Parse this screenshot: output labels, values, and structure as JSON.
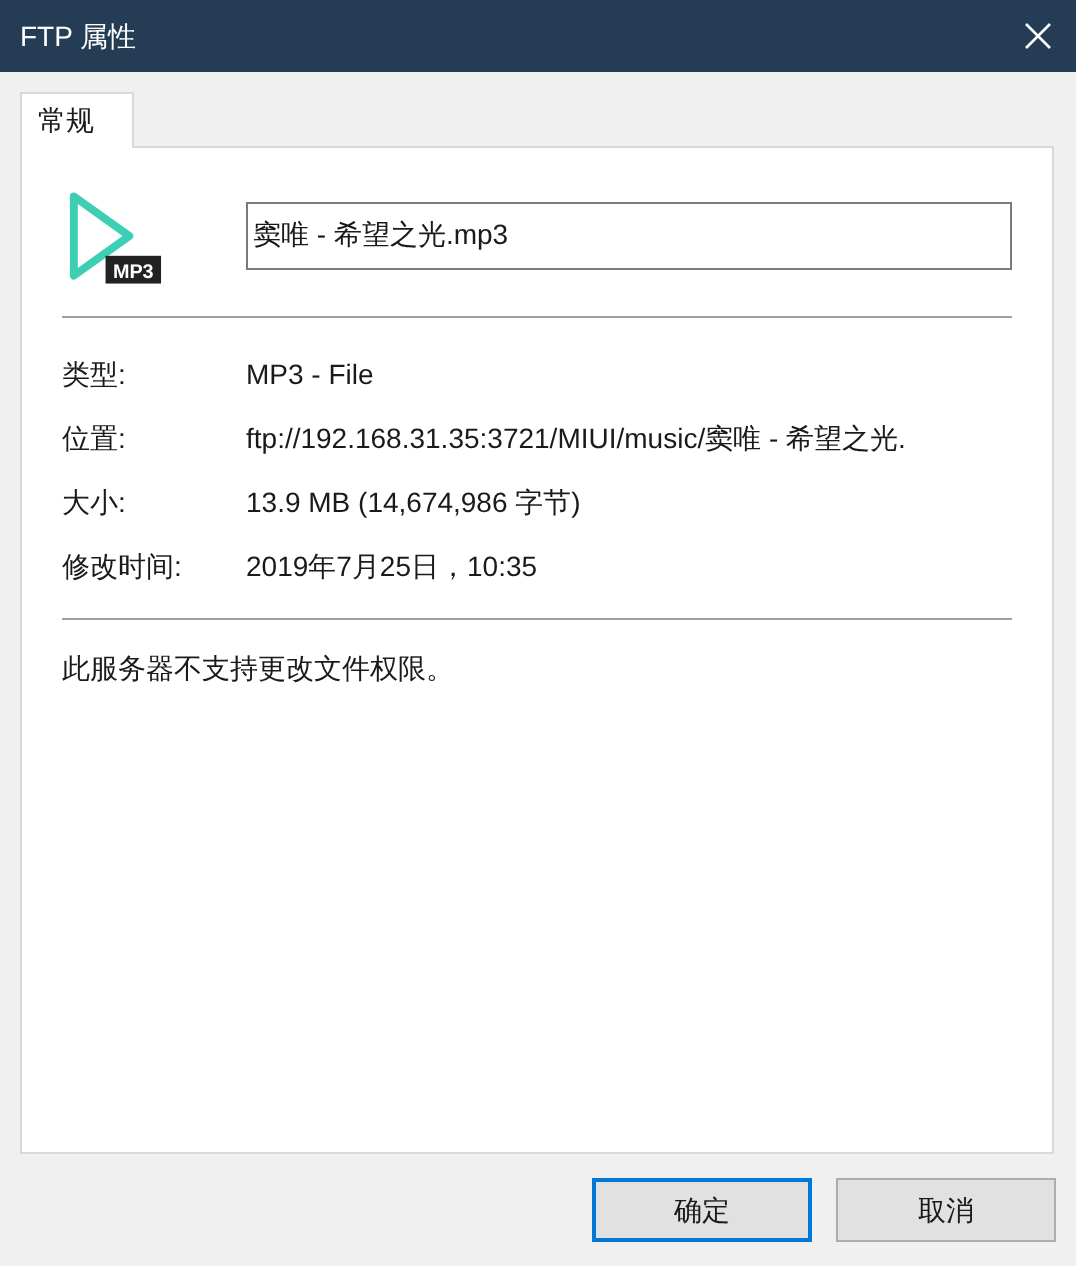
{
  "window": {
    "title": "FTP 属性"
  },
  "tabs": [
    {
      "label": "常规",
      "selected": true
    }
  ],
  "file_icon": {
    "badge": "MP3"
  },
  "file_name": {
    "value": "窦唯 - 希望之光.mp3"
  },
  "properties": [
    {
      "label": "类型:",
      "value": "MP3 - File"
    },
    {
      "label": "位置:",
      "value": "ftp://192.168.31.35:3721/MIUI/music/窦唯 - 希望之光."
    },
    {
      "label": "大小:",
      "value": "13.9 MB (14,674,986 字节)"
    },
    {
      "label": "修改时间:",
      "value": "2019年7月25日，10:35"
    }
  ],
  "message": "此服务器不支持更改文件权限。",
  "buttons": [
    {
      "label": "确定",
      "selected": true
    },
    {
      "label": "取消",
      "selected": false
    }
  ]
}
